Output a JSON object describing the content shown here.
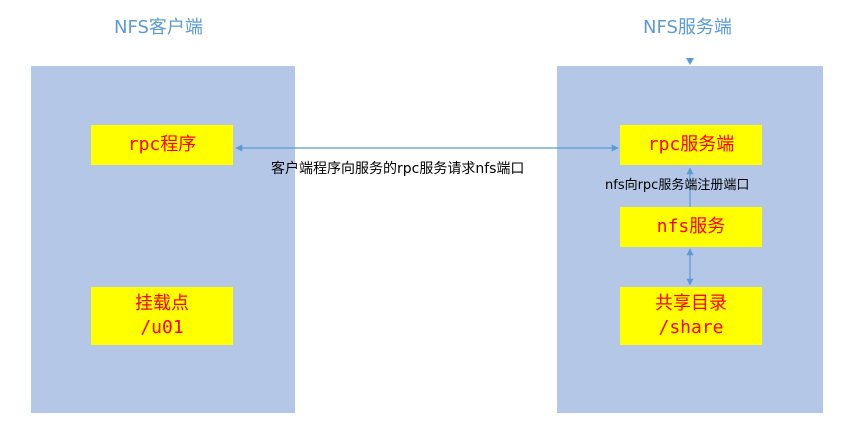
{
  "client": {
    "title": "NFS客户端",
    "rpc_program": "rpc程序",
    "mount_point": {
      "line1": "挂载点",
      "line2": "/u01"
    }
  },
  "server": {
    "title": "NFS服务端",
    "rpc_service": "rpc服务端",
    "nfs_service": "nfs服务",
    "shared_dir": {
      "line1": "共享目录",
      "line2": "/share"
    }
  },
  "arrows": {
    "client_to_server": "客户端程序向服务的rpc服务请求nfs端口",
    "register": "nfs向rpc服务端注册端口"
  },
  "colors": {
    "panel": "#b4c7e7",
    "box": "#ffff00",
    "box_text": "#ff0000",
    "title": "#5b9bd5",
    "arrow": "#5b9bd5"
  }
}
